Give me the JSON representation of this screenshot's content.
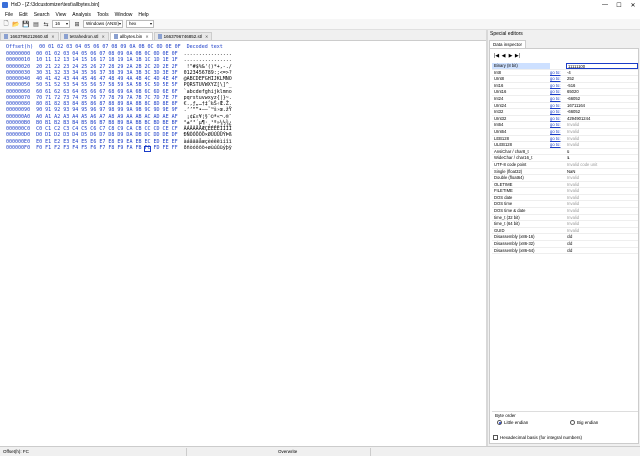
{
  "window": {
    "title": "HxD - [Z:\\3dcustomizer\\test\\allbytes.bin]",
    "minimize": "—",
    "maximize": "☐",
    "close": "✕"
  },
  "menu": [
    "File",
    "Edit",
    "Search",
    "View",
    "Analysis",
    "Tools",
    "Window",
    "Help"
  ],
  "toolbar": {
    "bytes_per_row": "16",
    "charset": "Windows (ANSI)",
    "display_mode": "hex"
  },
  "tabs": [
    {
      "label": "1663796212660.stl",
      "active": false
    },
    {
      "label": "tetrahedron.stl",
      "active": false
    },
    {
      "label": "allbytes.bin",
      "active": true
    },
    {
      "label": "1663796746852.stl",
      "active": false
    }
  ],
  "hex": {
    "header_offset": "Offset(h)",
    "header_columns": "00 01 02 03 04 05 06 07 08 09 0A 0B 0C 0D 0E 0F",
    "header_decoded": "Decoded text",
    "rows": [
      {
        "offset": "00000000",
        "bytes": "00 01 02 03 04 05 06 07 08 09 0A 0B 0C 0D 0E 0F",
        "text": "................"
      },
      {
        "offset": "00000010",
        "bytes": "10 11 12 13 14 15 16 17 18 19 1A 1B 1C 1D 1E 1F",
        "text": "................"
      },
      {
        "offset": "00000020",
        "bytes": "20 21 22 23 24 25 26 27 28 29 2A 2B 2C 2D 2E 2F",
        "text": " !\"#$%&'()*+,-./"
      },
      {
        "offset": "00000030",
        "bytes": "30 31 32 33 34 35 36 37 38 39 3A 3B 3C 3D 3E 3F",
        "text": "0123456789:;<=>?"
      },
      {
        "offset": "00000040",
        "bytes": "40 41 42 43 44 45 46 47 48 49 4A 4B 4C 4D 4E 4F",
        "text": "@ABCDEFGHIJKLMNO"
      },
      {
        "offset": "00000050",
        "bytes": "50 51 52 53 54 55 56 57 58 59 5A 5B 5C 5D 5E 5F",
        "text": "PQRSTUVWXYZ[\\]^_"
      },
      {
        "offset": "00000060",
        "bytes": "60 61 62 63 64 65 66 67 68 69 6A 6B 6C 6D 6E 6F",
        "text": "`abcdefghijklmno"
      },
      {
        "offset": "00000070",
        "bytes": "70 71 72 73 74 75 76 77 78 79 7A 7B 7C 7D 7E 7F",
        "text": "pqrstuvwxyz{|}~."
      },
      {
        "offset": "00000080",
        "bytes": "80 81 82 83 84 85 86 87 88 89 8A 8B 8C 8D 8E 8F",
        "text": "€.‚ƒ„…†‡ˆ‰Š‹Œ.Ž."
      },
      {
        "offset": "00000090",
        "bytes": "90 91 92 93 94 95 96 97 98 99 9A 9B 9C 9D 9E 9F",
        "text": ".‘’“”•–—˜™š›œ.žŸ"
      },
      {
        "offset": "000000A0",
        "bytes": "A0 A1 A2 A3 A4 A5 A6 A7 A8 A9 AA AB AC AD AE AF",
        "text": " ¡¢£¤¥¦§¨©ª«¬.®¯"
      },
      {
        "offset": "000000B0",
        "bytes": "B0 B1 B2 B3 B4 B5 B6 B7 B8 B9 BA BB BC BD BE BF",
        "text": "°±²³´µ¶·¸¹º»¼½¾¿"
      },
      {
        "offset": "000000C0",
        "bytes": "C0 C1 C2 C3 C4 C5 C6 C7 C8 C9 CA CB CC CD CE CF",
        "text": "ÀÁÂÃÄÅÆÇÈÉÊËÌÍÎÏ"
      },
      {
        "offset": "000000D0",
        "bytes": "D0 D1 D2 D3 D4 D5 D6 D7 D8 D9 DA DB DC DD DE DF",
        "text": "ÐÑÒÓÔÕÖ×ØÙÚÛÜÝÞß"
      },
      {
        "offset": "000000E0",
        "bytes": "E0 E1 E2 E3 E4 E5 E6 E7 E8 E9 EA EB EC ED EE EF",
        "text": "àáâãäåæçèéêëìíîï"
      },
      {
        "offset": "000000F0",
        "bytes": "F0 F1 F2 F3 F4 F5 F6 F7 F8 F9 FA FB FC FD FE FF",
        "text": "ðñòóôõö÷øùúûüýþÿ"
      }
    ]
  },
  "side": {
    "title": "Special editors",
    "tab": "Data inspector",
    "nav": [
      "|◀",
      "◀",
      "▶",
      "▶|"
    ],
    "rows": [
      {
        "name": "Binary (8 bit)",
        "goto": "",
        "value": "11111100",
        "invalid": false,
        "highlight": true
      },
      {
        "name": "Int8",
        "goto": "go to:",
        "value": "-4",
        "invalid": false
      },
      {
        "name": "UInt8",
        "goto": "go to:",
        "value": "252",
        "invalid": false
      },
      {
        "name": "Int16",
        "goto": "go to:",
        "value": "-516",
        "invalid": false
      },
      {
        "name": "UInt16",
        "goto": "go to:",
        "value": "65020",
        "invalid": false
      },
      {
        "name": "Int24",
        "goto": "go to:",
        "value": "-66052",
        "invalid": false
      },
      {
        "name": "UInt24",
        "goto": "go to:",
        "value": "16711164",
        "invalid": false
      },
      {
        "name": "Int32",
        "goto": "go to:",
        "value": "-66052",
        "invalid": false
      },
      {
        "name": "UInt32",
        "goto": "go to:",
        "value": "4294901244",
        "invalid": false
      },
      {
        "name": "Int64",
        "goto": "go to:",
        "value": "Invalid",
        "invalid": true
      },
      {
        "name": "UInt64",
        "goto": "go to:",
        "value": "Invalid",
        "invalid": true
      },
      {
        "name": "LEB128",
        "goto": "go to:",
        "value": "Invalid",
        "invalid": true
      },
      {
        "name": "ULEB128",
        "goto": "go to:",
        "value": "Invalid",
        "invalid": true
      },
      {
        "name": "AnsiChar / char8_t",
        "goto": "",
        "value": "ü",
        "invalid": false
      },
      {
        "name": "WideChar / char16_t",
        "goto": "",
        "value": "ﻼ",
        "invalid": false
      },
      {
        "name": "UTF-8 code point",
        "goto": "",
        "value": "Invalid code unit",
        "invalid": true
      },
      {
        "name": "Single (float32)",
        "goto": "",
        "value": "NaN",
        "invalid": false
      },
      {
        "name": "Double (float64)",
        "goto": "",
        "value": "Invalid",
        "invalid": true
      },
      {
        "name": "OLETIME",
        "goto": "",
        "value": "Invalid",
        "invalid": true
      },
      {
        "name": "FILETIME",
        "goto": "",
        "value": "Invalid",
        "invalid": true
      },
      {
        "name": "DOS date",
        "goto": "",
        "value": "Invalid",
        "invalid": true
      },
      {
        "name": "DOS time",
        "goto": "",
        "value": "Invalid",
        "invalid": true
      },
      {
        "name": "DOS time & date",
        "goto": "",
        "value": "Invalid",
        "invalid": true
      },
      {
        "name": "time_t (32 bit)",
        "goto": "",
        "value": "Invalid",
        "invalid": true
      },
      {
        "name": "time_t (64 bit)",
        "goto": "",
        "value": "Invalid",
        "invalid": true
      },
      {
        "name": "GUID",
        "goto": "",
        "value": "Invalid",
        "invalid": true
      },
      {
        "name": "Disassembly (x86-16)",
        "goto": "",
        "value": "cld",
        "invalid": false
      },
      {
        "name": "Disassembly (x86-32)",
        "goto": "",
        "value": "cld",
        "invalid": false
      },
      {
        "name": "Disassembly (x86-64)",
        "goto": "",
        "value": "cld",
        "invalid": false
      }
    ],
    "byte_order_label": "Byte order",
    "little_endian": "Little endian",
    "big_endian": "Big endian",
    "hex_basis": "Hexadecimal basis (for integral numbers)"
  },
  "status": {
    "offset": "Offset(h): FC",
    "mode": "Overwrite"
  }
}
